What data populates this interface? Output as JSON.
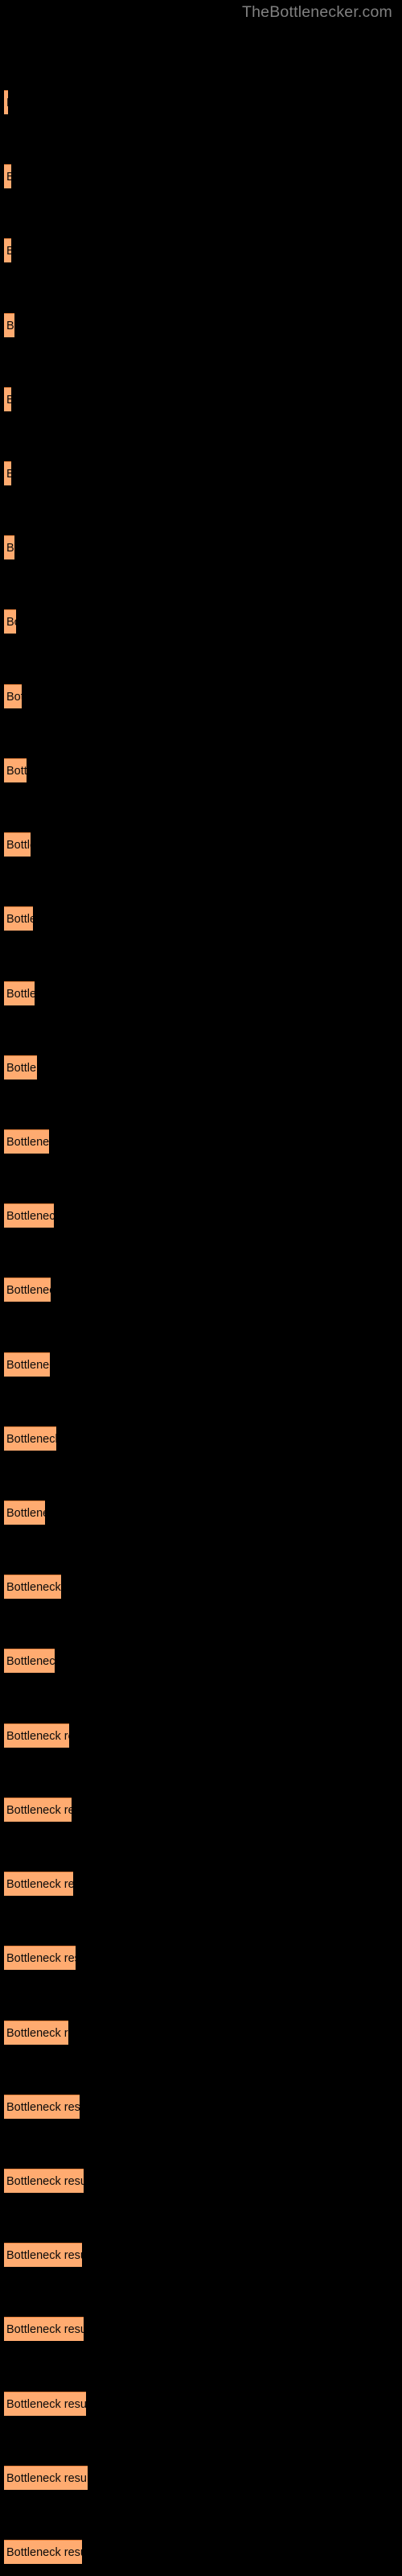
{
  "header": {
    "site_title": "TheBottlenecker.com",
    "color": "#808080"
  },
  "colors": {
    "background": "#000000",
    "bar_fill": "#ffab70",
    "bar_border": "#e8823c",
    "bar_label_text": "#0a0a0a"
  },
  "bar_label_text": "Bottleneck result",
  "chart_data": {
    "type": "bar",
    "orientation": "horizontal",
    "title": "",
    "subtitle": "",
    "xlabel": "",
    "ylabel": "",
    "grid": false,
    "legend": null,
    "categories": [
      "Bottleneck result",
      "Bottleneck result",
      "Bottleneck result",
      "Bottleneck result",
      "Bottleneck result",
      "Bottleneck result",
      "Bottleneck result",
      "Bottleneck result",
      "Bottleneck result",
      "Bottleneck result",
      "Bottleneck result",
      "Bottleneck result",
      "Bottleneck result",
      "Bottleneck result",
      "Bottleneck result",
      "Bottleneck result",
      "Bottleneck result",
      "Bottleneck result",
      "Bottleneck result",
      "Bottleneck result",
      "Bottleneck result",
      "Bottleneck result",
      "Bottleneck result",
      "Bottleneck result",
      "Bottleneck result",
      "Bottleneck result",
      "Bottleneck result",
      "Bottleneck result",
      "Bottleneck result",
      "Bottleneck result",
      "Bottleneck result",
      "Bottleneck result",
      "Bottleneck result",
      "Bottleneck result"
    ],
    "values": [
      5,
      9,
      9,
      13,
      9,
      9,
      13,
      15,
      22,
      28,
      33,
      36,
      72,
      82,
      115,
      125,
      120,
      117,
      134,
      104,
      145,
      129,
      167,
      172,
      177,
      184,
      164,
      193,
      203,
      200,
      204,
      210,
      214,
      199
    ],
    "bar_pixel_widths": [
      5,
      9,
      9,
      13,
      9,
      9,
      13,
      15,
      22,
      28,
      33,
      36,
      38,
      41,
      56,
      62,
      58,
      57,
      65,
      51,
      71,
      63,
      81,
      84,
      86,
      89,
      80,
      94,
      99,
      97,
      99,
      102,
      104,
      97
    ],
    "bar_tops": [
      112,
      155,
      198,
      241,
      284,
      327,
      370,
      413,
      456,
      499,
      542,
      586,
      629,
      672,
      715,
      759,
      802,
      845,
      888,
      932,
      975,
      1018,
      1062,
      1105,
      1148,
      1191,
      1235,
      1278,
      1321,
      1364,
      1408,
      1451,
      1494,
      1537
    ],
    "bar_count": 34,
    "xlim": [
      0,
      100
    ],
    "value_unit": "percent"
  }
}
